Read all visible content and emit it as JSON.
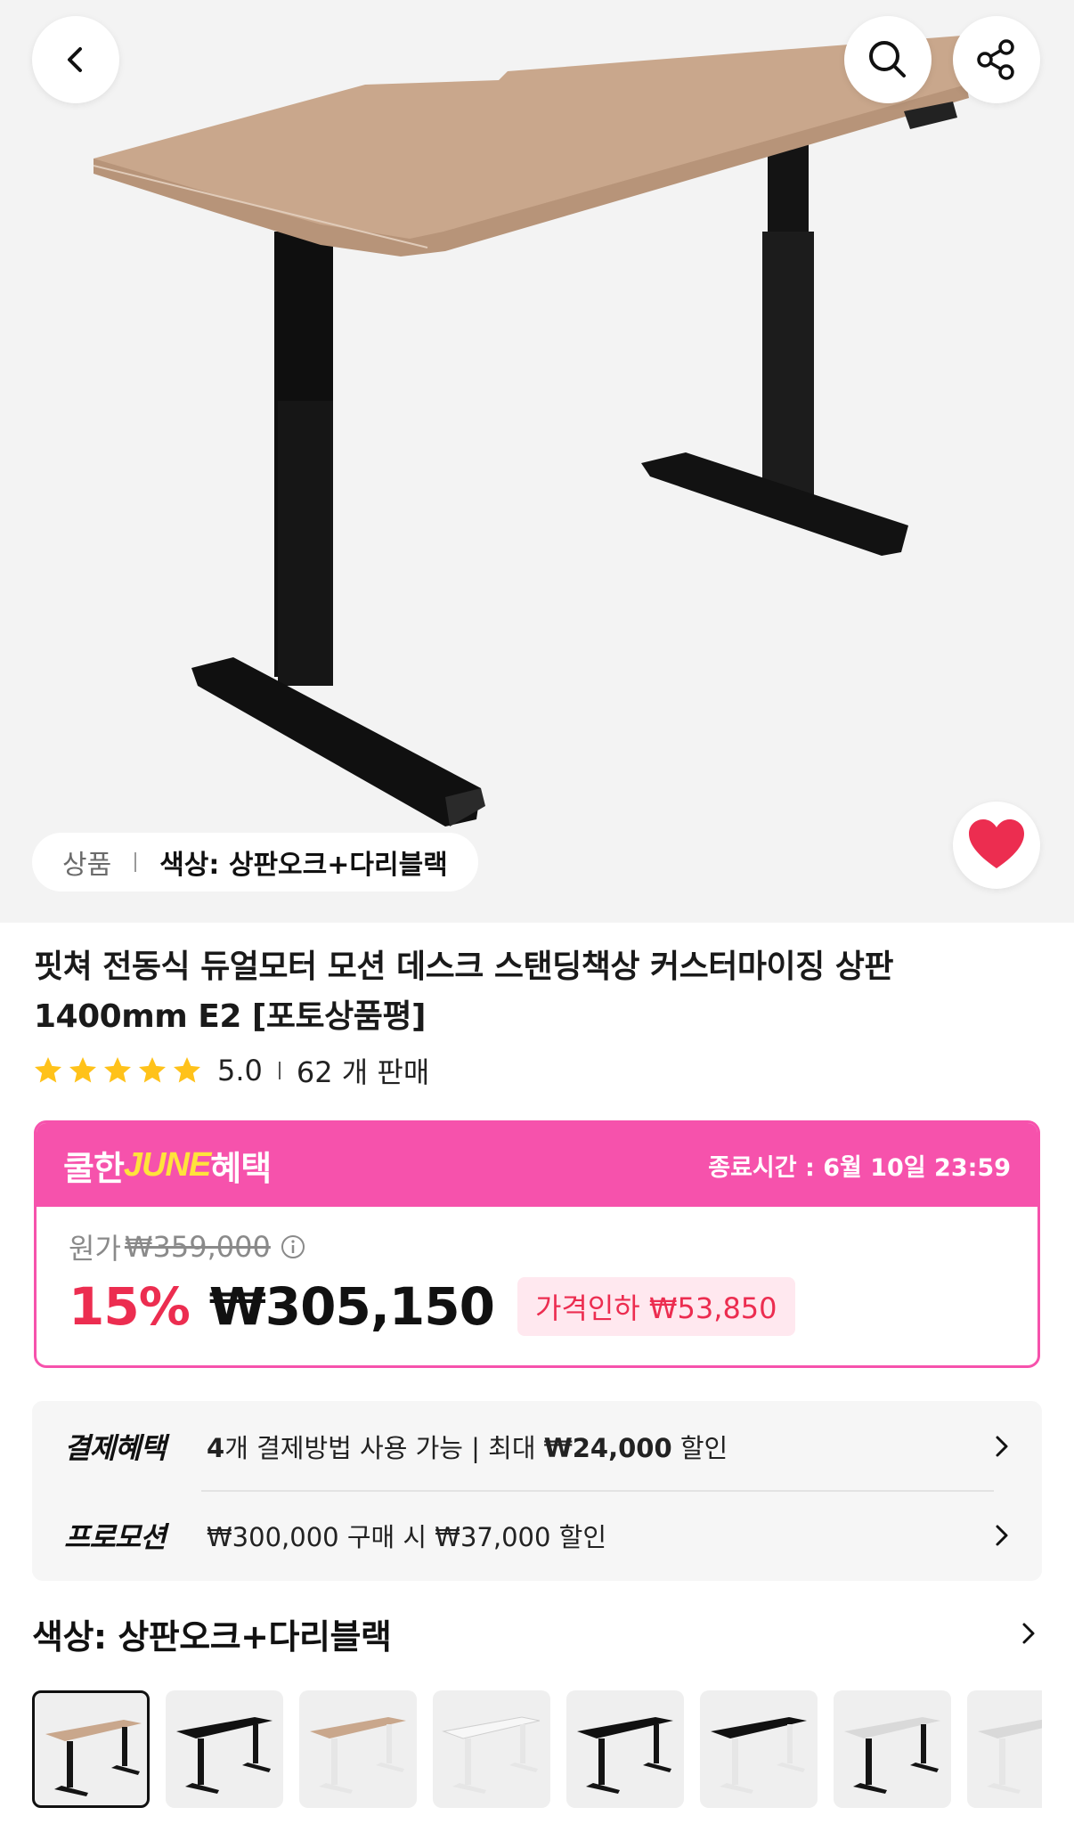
{
  "header": {
    "back_icon": "chevron-left-icon",
    "search_icon": "search-icon",
    "share_icon": "share-icon",
    "like_icon": "heart-icon",
    "like_color": "#ec2d50"
  },
  "hero_tag": {
    "category": "상품",
    "color_label": "색상: 상판오크+다리블랙"
  },
  "product": {
    "title": "핏쳐 전동식 듀얼모터 모션 데스크 스탠딩책상 커스터마이징 상판 1400mm E2 [포토상품평]",
    "rating": "5.0",
    "stars": 5,
    "star_color": "#ffc21a",
    "sales": "62 개 판매"
  },
  "promo": {
    "brand_prefix": "쿨한",
    "brand_highlight": "JUNE",
    "brand_suffix": "혜택",
    "end_time": "종료시간 : 6월 10일 23:59",
    "original_label": "원가",
    "original_price": "₩359,000",
    "discount_rate": "15%",
    "final_price": "₩305,150",
    "price_drop": "가격인하 ₩53,850",
    "accent_color": "#f652ac"
  },
  "benefits": {
    "payment_title": "결제혜택",
    "payment_count": "4",
    "payment_text_mid": "개 결제방법 사용 가능 | 최대 ",
    "payment_max": "₩24,000",
    "payment_text_end": " 할인",
    "promotion_title": "프로모션",
    "promotion_text": "₩300,000 구매 시 ₩37,000 할인"
  },
  "option": {
    "title": "색상: 상판오크+다리블랙",
    "swatches": [
      {
        "top": "oak",
        "legs": "black",
        "selected": true
      },
      {
        "top": "black",
        "legs": "black",
        "selected": false
      },
      {
        "top": "oak",
        "legs": "white",
        "selected": false
      },
      {
        "top": "white",
        "legs": "white",
        "selected": false
      },
      {
        "top": "black",
        "legs": "black",
        "selected": false
      },
      {
        "top": "black",
        "legs": "white",
        "selected": false
      },
      {
        "top": "gray",
        "legs": "black",
        "selected": false
      },
      {
        "top": "gray",
        "legs": "white",
        "selected": false
      }
    ]
  }
}
